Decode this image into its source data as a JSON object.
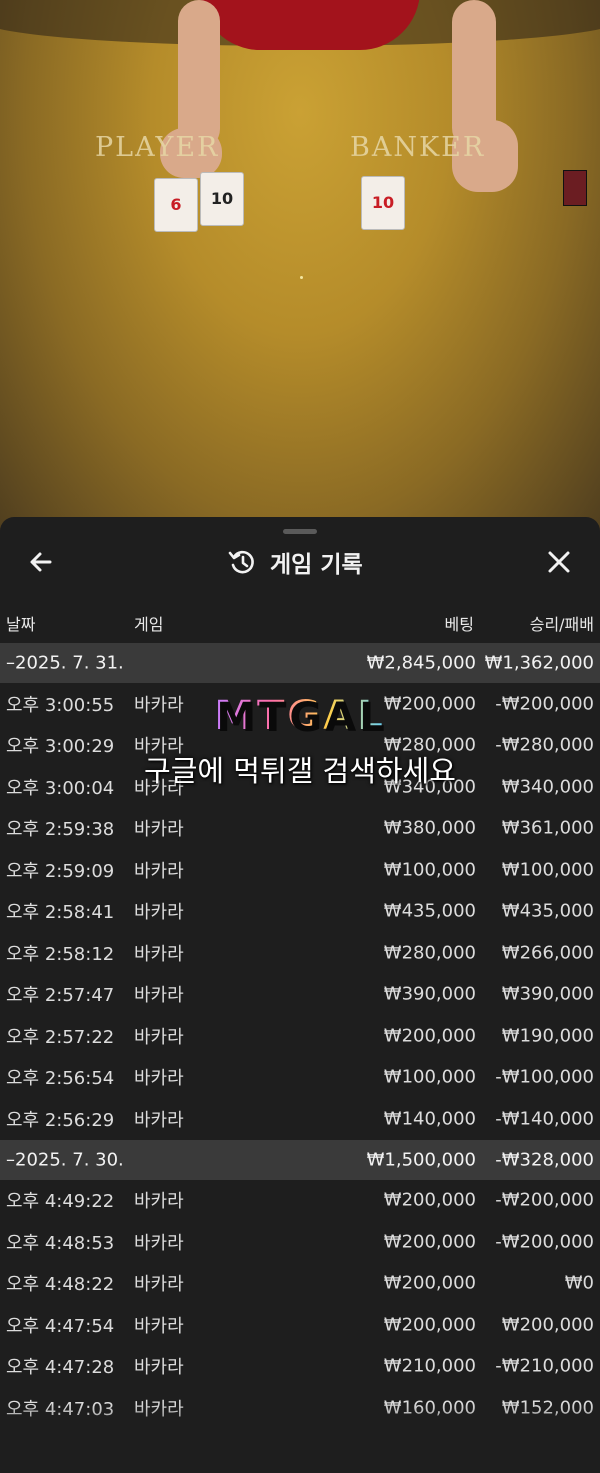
{
  "video": {
    "player_label": "PLAYER",
    "banker_label": "BANKER",
    "player_cards": [
      "6",
      "10"
    ],
    "banker_cards": [
      "10"
    ]
  },
  "header": {
    "title": "게임 기록",
    "back_icon": "arrow-left-icon",
    "history_icon": "history-clock-icon",
    "close_icon": "close-icon"
  },
  "columns": {
    "date": "날짜",
    "game": "게임",
    "bet": "베팅",
    "win_loss": "승리/패배"
  },
  "groups": [
    {
      "date": "–2025. 7. 31.",
      "total_bet": "₩2,845,000",
      "total_win_loss": "₩1,362,000",
      "rows": [
        {
          "time": "오후 3:00:55",
          "game": "바카라",
          "bet": "₩200,000",
          "win_loss": "-₩200,000"
        },
        {
          "time": "오후 3:00:29",
          "game": "바카라",
          "bet": "₩280,000",
          "win_loss": "-₩280,000"
        },
        {
          "time": "오후 3:00:04",
          "game": "바카라",
          "bet": "₩340,000",
          "win_loss": "₩340,000"
        },
        {
          "time": "오후 2:59:38",
          "game": "바카라",
          "bet": "₩380,000",
          "win_loss": "₩361,000"
        },
        {
          "time": "오후 2:59:09",
          "game": "바카라",
          "bet": "₩100,000",
          "win_loss": "₩100,000"
        },
        {
          "time": "오후 2:58:41",
          "game": "바카라",
          "bet": "₩435,000",
          "win_loss": "₩435,000"
        },
        {
          "time": "오후 2:58:12",
          "game": "바카라",
          "bet": "₩280,000",
          "win_loss": "₩266,000"
        },
        {
          "time": "오후 2:57:47",
          "game": "바카라",
          "bet": "₩390,000",
          "win_loss": "₩390,000"
        },
        {
          "time": "오후 2:57:22",
          "game": "바카라",
          "bet": "₩200,000",
          "win_loss": "₩190,000"
        },
        {
          "time": "오후 2:56:54",
          "game": "바카라",
          "bet": "₩100,000",
          "win_loss": "-₩100,000"
        },
        {
          "time": "오후 2:56:29",
          "game": "바카라",
          "bet": "₩140,000",
          "win_loss": "-₩140,000"
        }
      ]
    },
    {
      "date": "–2025. 7. 30.",
      "total_bet": "₩1,500,000",
      "total_win_loss": "-₩328,000",
      "rows": [
        {
          "time": "오후 4:49:22",
          "game": "바카라",
          "bet": "₩200,000",
          "win_loss": "-₩200,000"
        },
        {
          "time": "오후 4:48:53",
          "game": "바카라",
          "bet": "₩200,000",
          "win_loss": "-₩200,000"
        },
        {
          "time": "오후 4:48:22",
          "game": "바카라",
          "bet": "₩200,000",
          "win_loss": "₩0"
        },
        {
          "time": "오후 4:47:54",
          "game": "바카라",
          "bet": "₩200,000",
          "win_loss": "₩200,000"
        },
        {
          "time": "오후 4:47:28",
          "game": "바카라",
          "bet": "₩210,000",
          "win_loss": "-₩210,000"
        },
        {
          "time": "오후 4:47:03",
          "game": "바카라",
          "bet": "₩160,000",
          "win_loss": "₩152,000"
        }
      ]
    }
  ],
  "watermark": {
    "logo": "MTGAL",
    "text": "구글에 먹튀갤 검색하세요"
  },
  "colors": {
    "sheet_bg": "#1e1e1e",
    "date_row_bg": "#3a3a3a",
    "table_felt": "#b58c2a"
  }
}
